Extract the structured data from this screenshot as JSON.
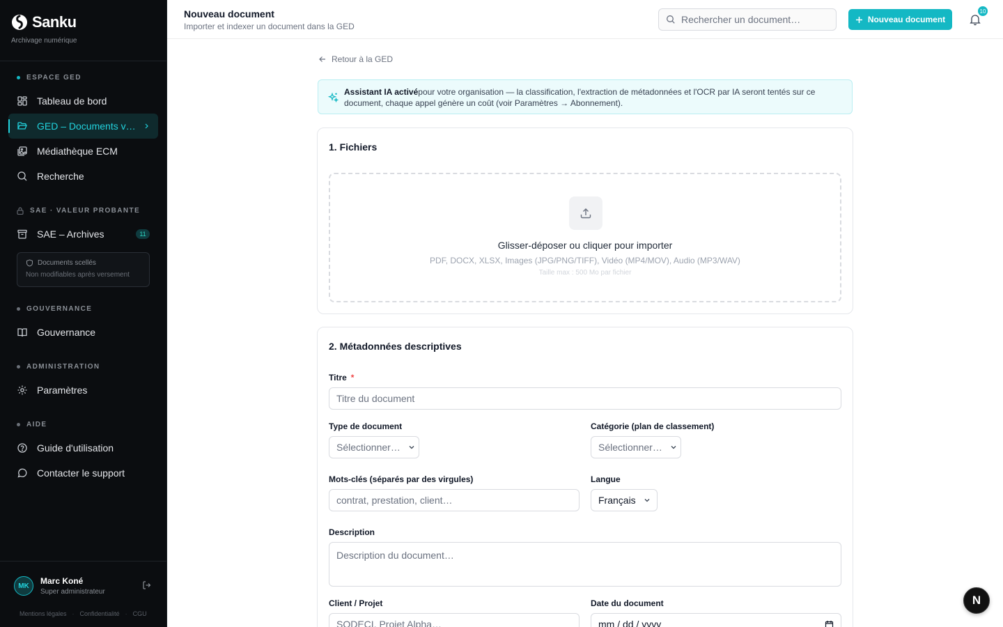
{
  "brand": {
    "name": "Sanku",
    "tagline": "Archivage numérique"
  },
  "sidebar": {
    "sections": [
      {
        "label": "ESPACE GED"
      },
      {
        "label": "SAE · VALEUR PROBANTE"
      },
      {
        "label": "GOUVERNANCE"
      },
      {
        "label": "ADMINISTRATION"
      },
      {
        "label": "AIDE"
      }
    ],
    "items": [
      {
        "label": "Tableau de bord",
        "icon": "dashboard-icon"
      },
      {
        "label": "GED – Documents v…",
        "icon": "folder-open-icon",
        "active": true
      },
      {
        "label": "Médiathèque ECM",
        "icon": "media-library-icon"
      },
      {
        "label": "Recherche",
        "icon": "search-icon"
      },
      {
        "label": "SAE – Archives",
        "icon": "archive-icon",
        "badge": "11"
      },
      {
        "label": "Gouvernance",
        "icon": "book-open-icon"
      },
      {
        "label": "Paramètres",
        "icon": "gear-icon"
      },
      {
        "label": "Guide d'utilisation",
        "icon": "help-circle-icon"
      },
      {
        "label": "Contacter le support",
        "icon": "message-circle-icon"
      }
    ],
    "sealed": {
      "title": "Documents scellés",
      "subtitle": "Non modifiables après versement"
    },
    "user": {
      "initials": "MK",
      "name": "Marc Koné",
      "role": "Super administrateur"
    },
    "legal": [
      "Mentions légales",
      "Confidentialité",
      "CGU"
    ]
  },
  "header": {
    "title": "Nouveau document",
    "subtitle": "Importer et indexer un document dans la GED",
    "search_placeholder": "Rechercher un document…",
    "new_button": "Nouveau document",
    "notification_count": "10"
  },
  "main": {
    "back_link": "Retour à la GED",
    "ai_banner": {
      "strong": "Assistant IA activé",
      "text": "pour votre organisation — la classification, l'extraction de métadonnées et l'OCR par IA seront tentés sur ce document, chaque appel génère un coût (voir Paramètres → Abonnement)."
    },
    "files_section": {
      "title": "1. Fichiers",
      "drop_main": "Glisser-déposer ou cliquer pour importer",
      "drop_formats": "PDF, DOCX, XLSX, Images (JPG/PNG/TIFF), Vidéo (MP4/MOV), Audio (MP3/WAV)",
      "drop_max": "Taille max : 500 Mo par fichier"
    },
    "meta_section": {
      "title": "2. Métadonnées descriptives",
      "title_label": "Titre",
      "required_mark": "*",
      "title_placeholder": "Titre du document",
      "doc_type_label": "Type de document",
      "doc_type_value": "Sélectionner…",
      "category_label": "Catégorie (plan de classement)",
      "category_value": "Sélectionner…",
      "keywords_label": "Mots-clés (séparés par des virgules)",
      "keywords_placeholder": "contrat, prestation, client…",
      "language_label": "Langue",
      "language_value": "Français",
      "description_label": "Description",
      "description_placeholder": "Description du document…",
      "client_label": "Client / Projet",
      "client_placeholder": "SODECI, Projet Alpha…",
      "date_label": "Date du document",
      "date_value": "mm / dd / yyyy"
    }
  },
  "fab_label": "N",
  "colors": {
    "accent": "#14b8c4",
    "sidebar_bg": "#0b0d10",
    "active_text": "#22d3de"
  }
}
